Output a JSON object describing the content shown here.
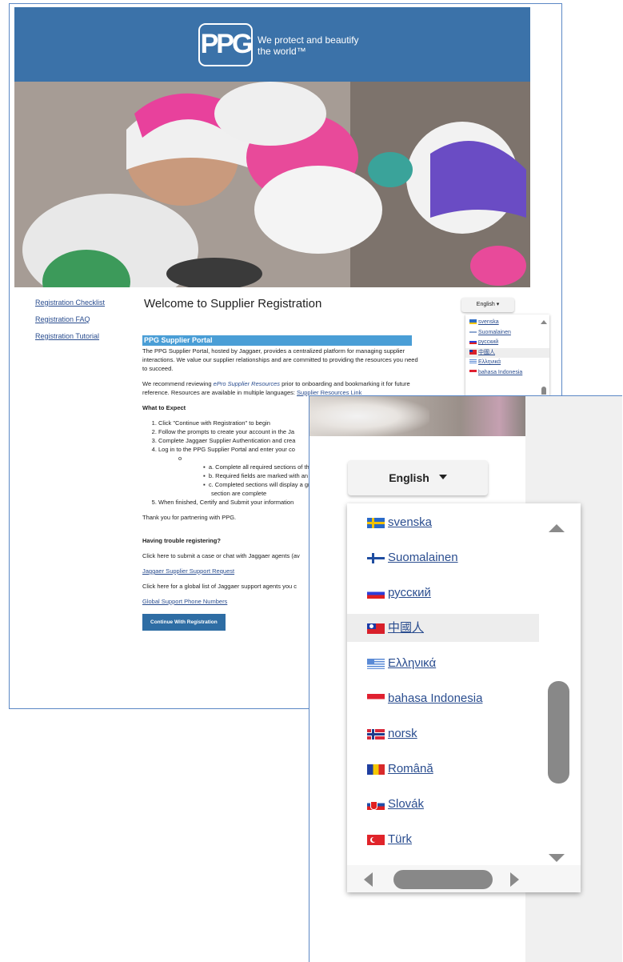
{
  "header": {
    "logo_text": "PPG",
    "tagline": "We protect and beautify the world™"
  },
  "sidebar": {
    "links": [
      "Registration Checklist",
      "Registration FAQ",
      "Registration Tutorial"
    ]
  },
  "main": {
    "title": "Welcome to Supplier Registration",
    "portal_heading": "PPG Supplier Portal",
    "intro_p1": "The PPG Supplier Portal, hosted by Jaggaer, provides a centralized platform for managing supplier interactions. We value our supplier relationships and are committed to providing the resources you need to succeed.",
    "intro_p2_before": "We recommend reviewing ",
    "intro_p2_em": "ePro Supplier Resources",
    "intro_p2_after": " prior to onboarding and bookmarking it for future reference. Resources are available in multiple languages: ",
    "intro_p2_link": "Supplier Resources Link",
    "expect_heading": "What to Expect",
    "steps": [
      "Click \"Continue with Registration\" to begin",
      "Follow the prompts to create your account in the Ja",
      "Complete Jaggaer Supplier Authentication and crea",
      "Log in to the PPG Supplier Portal and enter your co"
    ],
    "substeps": [
      "a. Complete all required sections of th",
      "b. Required fields are marked with an a",
      "c. Completed sections will display a gr",
      "section are complete"
    ],
    "step5": "When finished, Certify and Submit your information",
    "thanks": "Thank you for partnering with PPG.",
    "trouble_heading": "Having trouble registering?",
    "trouble_p1": "Click here to submit a case or chat with Jaggaer agents (av",
    "support_link": "Jaggaer Supplier Support Request",
    "trouble_p2": "Click here for a global list of Jaggaer support agents you c",
    "phone_link": "Global Support Phone Numbers",
    "continue_button": "Continue With Registration"
  },
  "language": {
    "selected": "English",
    "options_small": [
      "svenska",
      "Suomalainen",
      "русский",
      "中國人",
      "Ελληνικά",
      "bahasa Indonesia"
    ],
    "options_zoom": [
      {
        "label": "svenska",
        "flag": "sweden"
      },
      {
        "label": "Suomalainen",
        "flag": "finland"
      },
      {
        "label": "русский",
        "flag": "russia"
      },
      {
        "label": "中國人",
        "flag": "taiwan"
      },
      {
        "label": "Ελληνικά",
        "flag": "greece"
      },
      {
        "label": "bahasa Indonesia",
        "flag": "indonesia"
      },
      {
        "label": "norsk",
        "flag": "norway"
      },
      {
        "label": "Română",
        "flag": "romania"
      },
      {
        "label": "Slovák",
        "flag": "slovakia"
      },
      {
        "label": "Türk",
        "flag": "turkey"
      }
    ],
    "highlighted_index": 3
  },
  "colors": {
    "banner": "#3b72a9",
    "link": "#2a4d8f",
    "portal_heading_bg": "#4a9ed6",
    "button": "#2e6da4"
  }
}
